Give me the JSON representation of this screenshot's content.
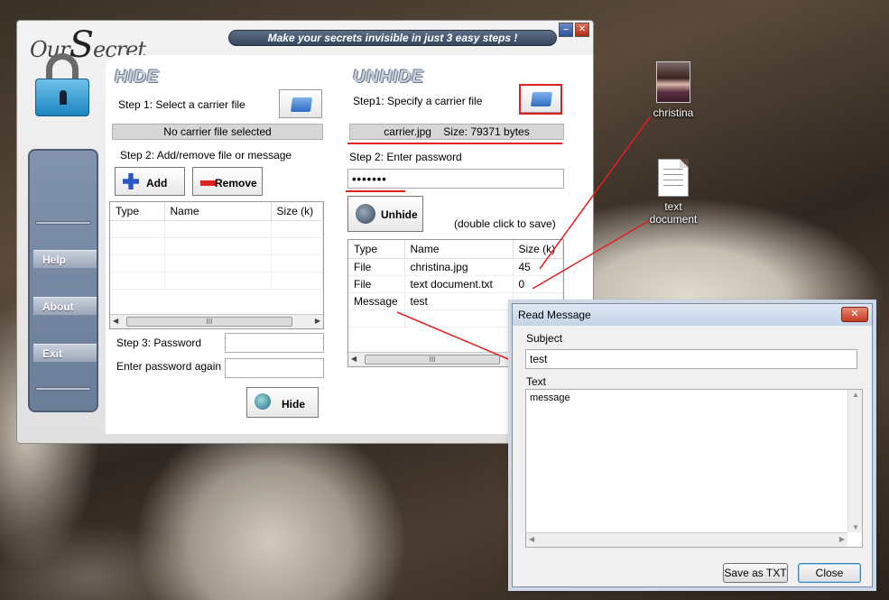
{
  "desktop": {
    "icons": [
      {
        "label": "christina",
        "icon": "photo-icon"
      },
      {
        "label": "text\ndocument",
        "icon": "text-document-icon"
      }
    ]
  },
  "main": {
    "logo": {
      "our": "Our",
      "s": "S",
      "ecret": "ecret"
    },
    "banner": "Make your secrets invisible in just 3 easy steps !",
    "sidebar": {
      "help": "Help",
      "about": "About",
      "exit": "Exit"
    },
    "hide": {
      "title": "HIDE",
      "step1": "Step 1: Select a carrier file",
      "carrier_status": "No carrier file selected",
      "step2": "Step 2: Add/remove file or message",
      "add_label": "Add",
      "remove_label": "Remove",
      "columns": [
        "Type",
        "Name",
        "Size (k)"
      ],
      "step3": "Step 3: Password",
      "password_again": "Enter password again",
      "hide_label": "Hide",
      "password_value": "",
      "password_again_value": ""
    },
    "unhide": {
      "title": "UNHIDE",
      "step1": "Step1: Specify a carrier file",
      "carrier_info": "carrier.jpg    Size: 79371 bytes",
      "step2": "Step 2: Enter password",
      "password_value": "•••••••",
      "unhide_label": "Unhide",
      "hint": "(double click to save)",
      "columns": [
        "Type",
        "Name",
        "Size (k)"
      ],
      "rows": [
        {
          "type": "File",
          "name": "christina.jpg",
          "size": "45"
        },
        {
          "type": "File",
          "name": "text document.txt",
          "size": "0"
        },
        {
          "type": "Message",
          "name": "test",
          "size": ""
        }
      ]
    },
    "scroll_thumb": "III"
  },
  "dialog": {
    "title": "Read Message",
    "subject_label": "Subject",
    "subject_value": "test",
    "text_label": "Text",
    "text_value": "message",
    "save_label": "Save as TXT",
    "close_label": "Close"
  },
  "colors": {
    "annotation": "#e02020",
    "banner": "#36465c",
    "sidebar": "#6a7d99"
  }
}
